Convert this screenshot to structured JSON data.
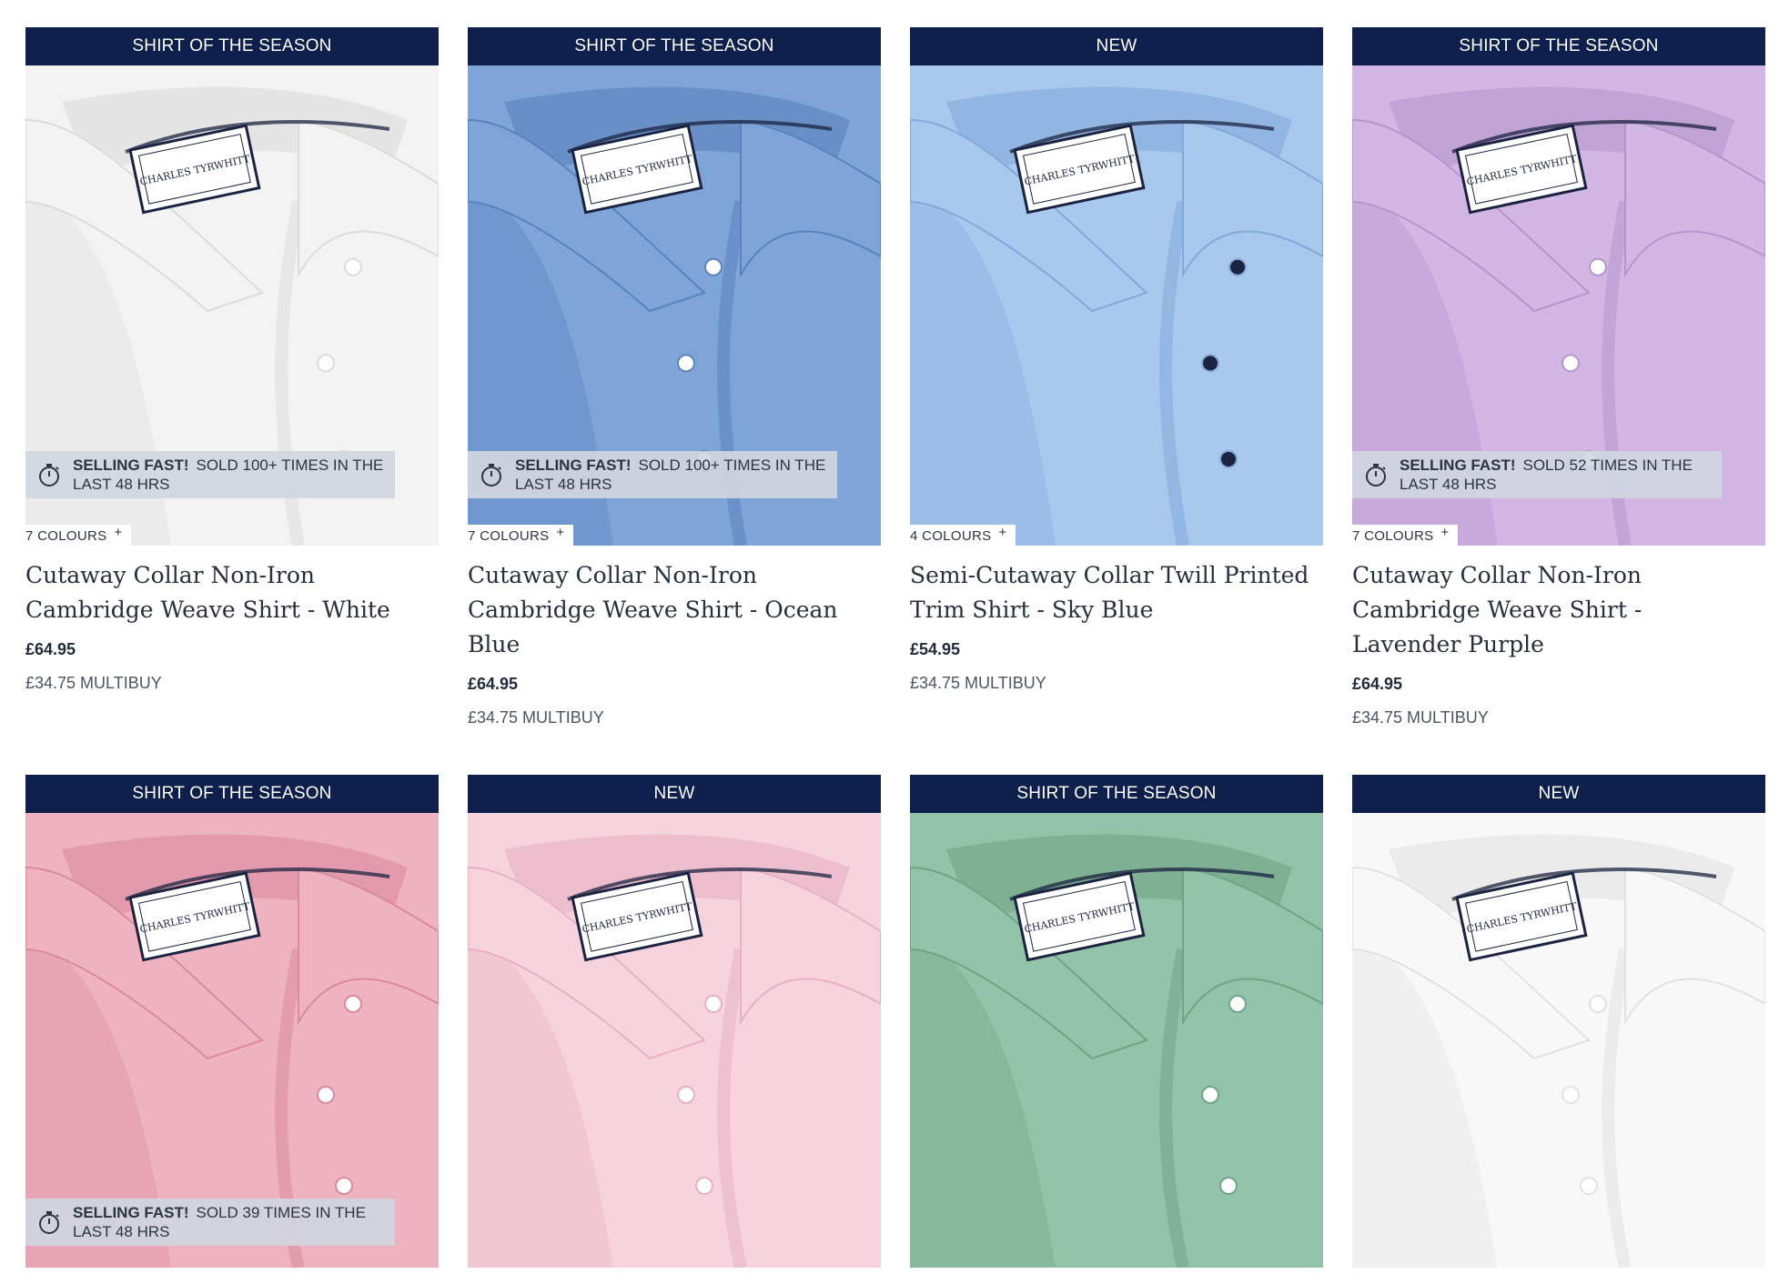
{
  "products": [
    {
      "badge": "SHIRT OF THE SEASON",
      "name": "Cutaway Collar Non-Iron Cambridge Weave Shirt - White",
      "price": "£64.95",
      "multibuy": "£34.75 MULTIBUY",
      "colours": "7 COLOURS",
      "selling_fast_label": "SELLING FAST!",
      "selling_fast_text": "SOLD 100+ TIMES IN THE LAST 48 HRS",
      "image_color": "#f3f3f3",
      "image_shade": "#dcdcdc",
      "image_label": "CHARLES TYRWHITT"
    },
    {
      "badge": "SHIRT OF THE SEASON",
      "name": "Cutaway Collar Non-Iron Cambridge Weave Shirt - Ocean Blue",
      "price": "£64.95",
      "multibuy": "£34.75 MULTIBUY",
      "colours": "7 COLOURS",
      "selling_fast_label": "SELLING FAST!",
      "selling_fast_text": "SOLD 100+ TIMES IN THE LAST 48 HRS",
      "image_color": "#7ea4d8",
      "image_shade": "#5a83bd",
      "image_label": "CHARLES TYRWHITT"
    },
    {
      "badge": "NEW",
      "name": "Semi-Cutaway Collar Twill Printed Trim Shirt - Sky Blue",
      "price": "£54.95",
      "multibuy": "£34.75 MULTIBUY",
      "colours": "4 COLOURS",
      "image_color": "#a8c8ee",
      "image_shade": "#84a9d9",
      "image_label": "CHARLES TYRWHITT"
    },
    {
      "badge": "SHIRT OF THE SEASON",
      "name": "Cutaway Collar Non-Iron Cambridge Weave Shirt - Lavender Purple",
      "price": "£64.95",
      "multibuy": "£34.75 MULTIBUY",
      "colours": "7 COLOURS",
      "selling_fast_label": "SELLING FAST!",
      "selling_fast_text": "SOLD 52 TIMES IN THE LAST 48 HRS",
      "image_color": "#d2b6e4",
      "image_shade": "#b596cc",
      "image_label": "CHARLES TYRWHITT"
    },
    {
      "badge": "SHIRT OF THE SEASON",
      "selling_fast_label": "SELLING FAST!",
      "selling_fast_text": "SOLD 39 TIMES IN THE LAST 48 HRS",
      "image_color": "#efb2c0",
      "image_shade": "#d98a9f",
      "image_label": "CHARLES TYRWHITT"
    },
    {
      "badge": "NEW",
      "image_color": "#f7d3de",
      "image_shade": "#e6b2c3",
      "image_label": "CHARLES TYRWHITT"
    },
    {
      "badge": "SHIRT OF THE SEASON",
      "image_color": "#93c3a8",
      "image_shade": "#6fa486",
      "image_label": "CHARLES TYRWHITT"
    },
    {
      "badge": "NEW",
      "image_color": "#f8f8f8",
      "image_shade": "#e2e2e2",
      "image_label": "CHARLES TYRWHITT"
    }
  ]
}
